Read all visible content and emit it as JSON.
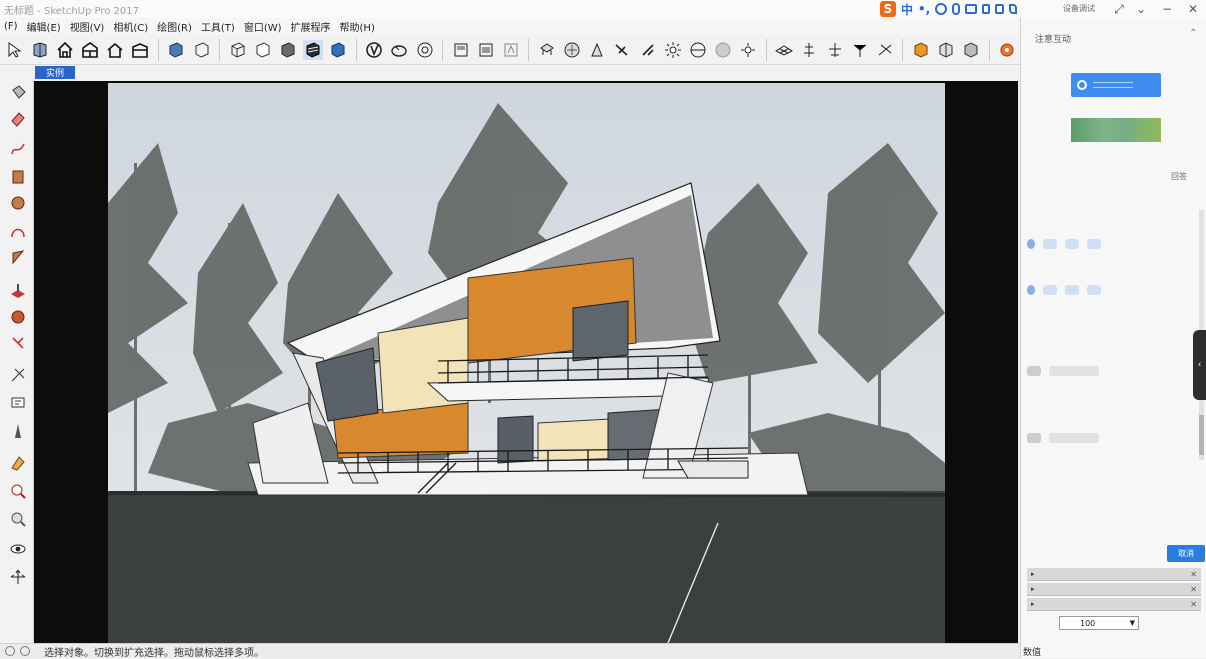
{
  "window": {
    "title": "无标题 - SketchUp Pro 2017",
    "share_label": "设备调试",
    "minimize_glyph": "−",
    "restore_glyph": "⌄",
    "close_glyph": "✕"
  },
  "ime": {
    "logo": "S",
    "mode": "中",
    "punct": "•,"
  },
  "menu": [
    "(F)",
    "编辑(E)",
    "视图(V)",
    "相机(C)",
    "绘图(R)",
    "工具(T)",
    "窗口(W)",
    "扩展程序",
    "帮助(H)"
  ],
  "toolbar": {
    "icons": [
      "select-icon",
      "component-icon",
      "home-icon",
      "warehouse-icon",
      "house-outline-icon",
      "shed-icon",
      "style-xray-icon",
      "style-back-edges-icon",
      "wireframe-icon",
      "hidden-line-icon",
      "shaded-icon",
      "shaded-textures-icon",
      "monochrome-icon",
      "move-tool-icon",
      "follow-me-icon",
      "offset-icon",
      "section-plane-icon",
      "section-display-icon",
      "section-cut-icon",
      "dimensions-icon",
      "protractor-icon",
      "text-icon",
      "axes-icon",
      "3d-text-icon",
      "sun-shadow-icon",
      "fog-icon",
      "match-photo-icon",
      "edge-style-icon",
      "sandbox-icon",
      "smoove-icon",
      "stamp-icon",
      "drape-icon",
      "add-detail-icon",
      "flip-edge-icon",
      "warehouse-get-icon",
      "share-model-icon",
      "extension-icon",
      "ruby-icon"
    ]
  },
  "scene_tab": "实例",
  "left_tools": [
    "paint-bucket-icon",
    "eraser-icon",
    "freehand-icon",
    "rectangle-icon",
    "circle-icon",
    "arc-icon",
    "polygon-icon",
    "push-pull-icon",
    "rotate-icon",
    "follow-me-tool-icon",
    "scale-icon",
    "text-label-icon",
    "dimension-icon",
    "tape-measure-icon",
    "orbit-icon",
    "zoom-icon",
    "zoom-window-icon",
    "look-around-icon",
    "walk-icon"
  ],
  "status": {
    "text": "选择对象。切换到扩充选择。拖动鼠标选择多项。",
    "measurements_label": "数值"
  },
  "tray": {
    "title": "注意互动",
    "reply_label": "回答",
    "cancel_label": "取消",
    "select_value": "100",
    "panels": [
      "▸",
      "▸",
      "▸"
    ]
  },
  "scene": {
    "colors": {
      "sky": "#d8dde2",
      "ground": "#3a3e3c",
      "wood": "#d8892e",
      "cream": "#f2e4b8",
      "glass": "#5a6168",
      "trees": "#4a4f4c"
    }
  }
}
